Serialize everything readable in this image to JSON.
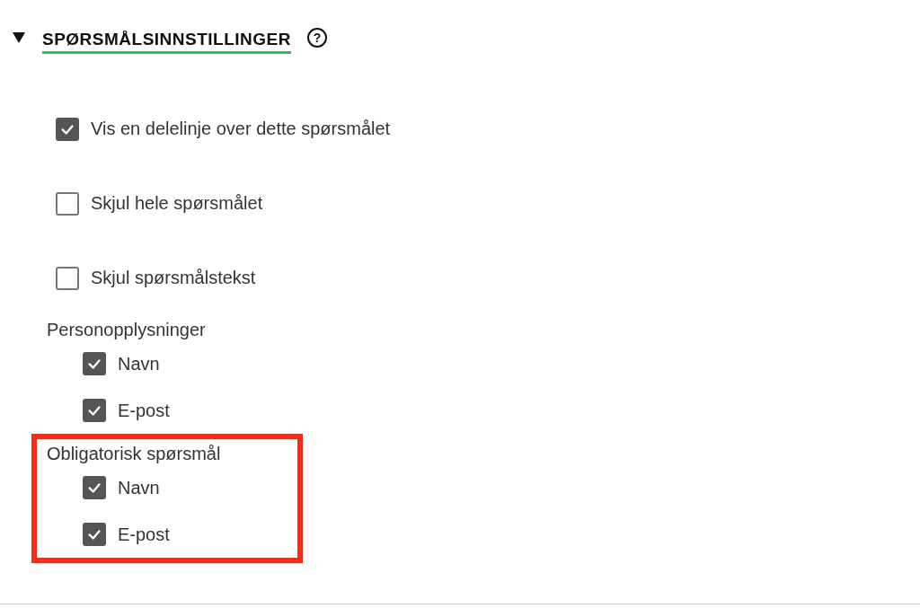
{
  "section": {
    "title": "SPØRSMÅLSINNSTILLINGER",
    "expanded": true,
    "help": "?"
  },
  "options": [
    {
      "label": "Vis en delelinje over dette spørsmålet",
      "checked": true
    },
    {
      "label": "Skjul hele spørsmålet",
      "checked": false
    },
    {
      "label": "Skjul spørsmålstekst",
      "checked": false
    }
  ],
  "groups": [
    {
      "label": "Personopplysninger",
      "highlighted": false,
      "items": [
        {
          "label": "Navn",
          "checked": true
        },
        {
          "label": "E-post",
          "checked": true
        }
      ]
    },
    {
      "label": "Obligatorisk spørsmål",
      "highlighted": true,
      "items": [
        {
          "label": "Navn",
          "checked": true
        },
        {
          "label": "E-post",
          "checked": true
        }
      ]
    }
  ]
}
